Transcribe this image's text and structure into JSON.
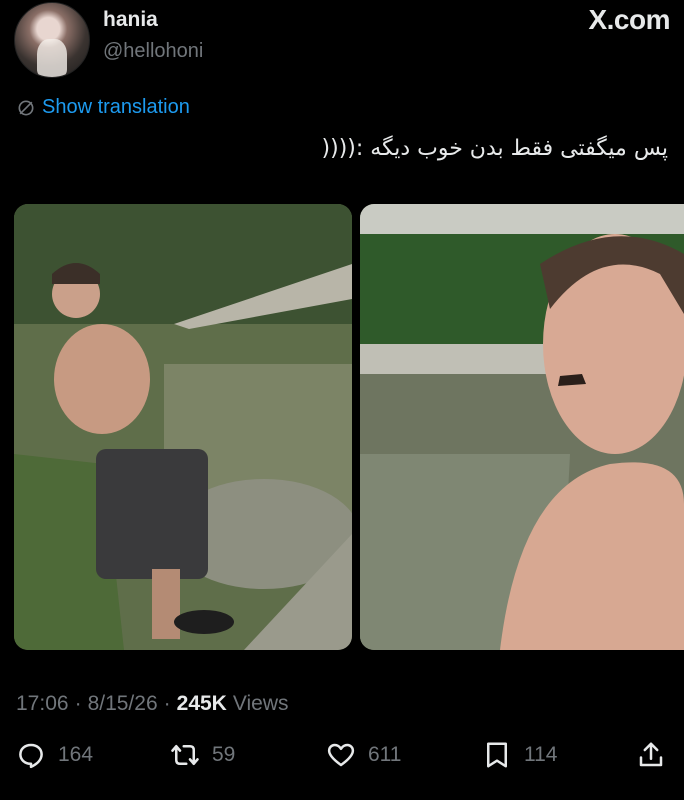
{
  "author": {
    "display_name": "hania",
    "handle": "@hellohoni"
  },
  "site_badge": "X.com",
  "translate_label": "Show translation",
  "tweet_text": "پس میگفتی فقط بدن خوب دیگه :((((",
  "meta": {
    "time": "17:06",
    "dot1": "·",
    "date": "8/15/26",
    "dot2": "·",
    "views_count": "245K",
    "views_label": "Views"
  },
  "actions": {
    "replies": "164",
    "reposts": "59",
    "likes": "611",
    "bookmarks": "114"
  },
  "icons": [
    "globe-icon",
    "reply-icon",
    "repost-icon",
    "like-icon",
    "bookmark-icon",
    "share-icon"
  ],
  "colors": {
    "background": "#000000",
    "text": "#e7e9ea",
    "muted": "#71767b",
    "link": "#1d9bf0"
  }
}
